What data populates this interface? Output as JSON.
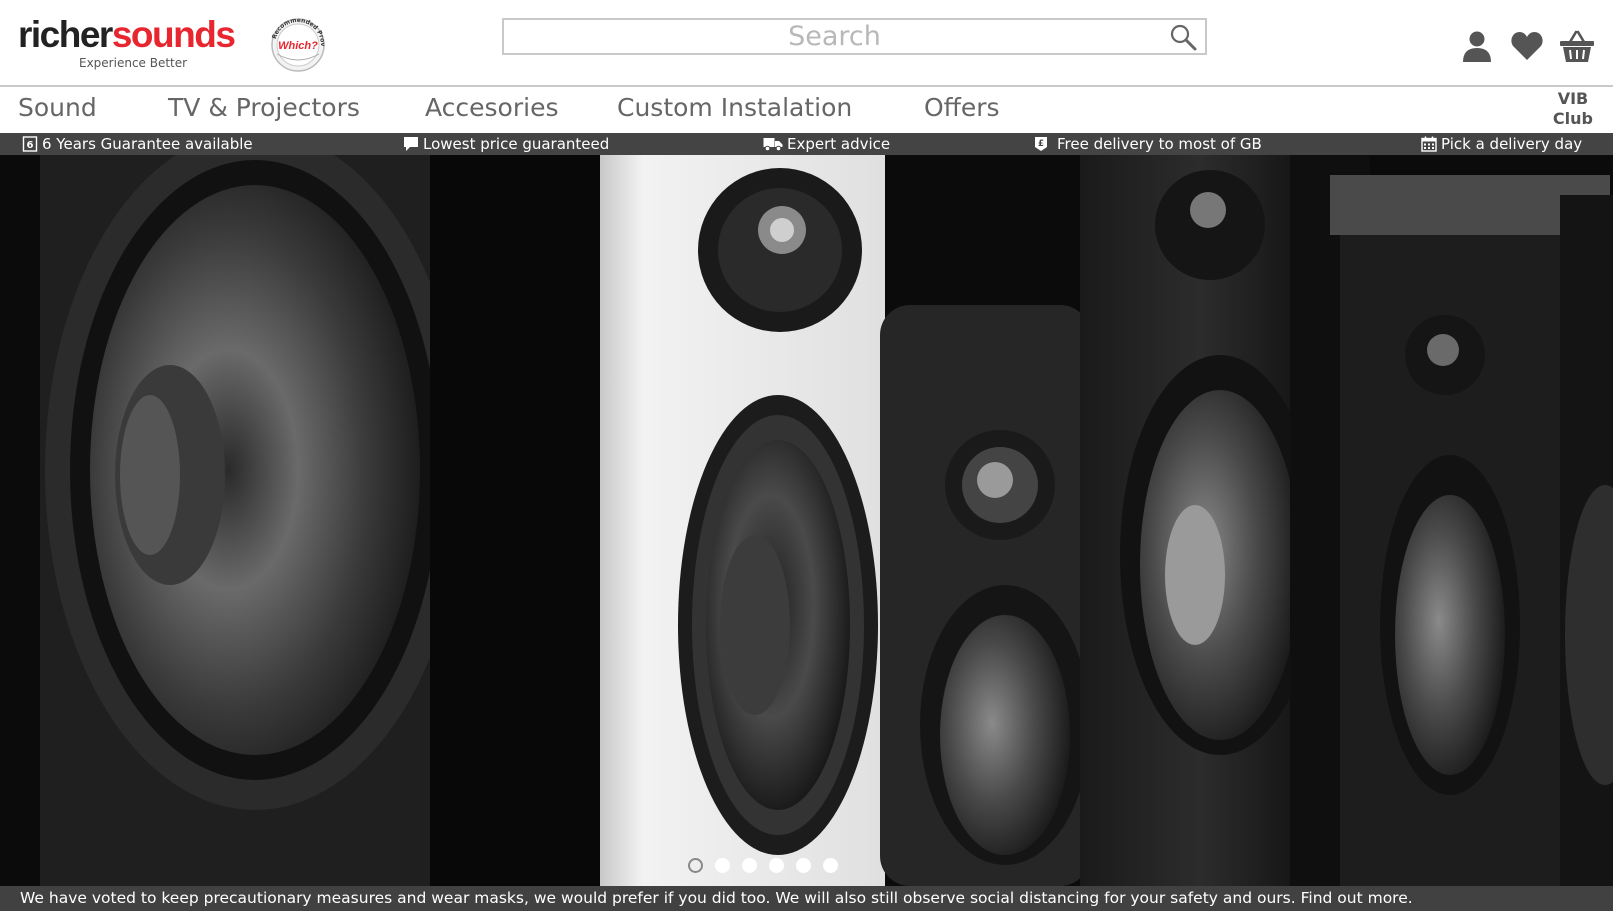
{
  "brand": {
    "name_part1": "richer",
    "name_part2": "sounds",
    "tagline": "Experience Better",
    "badge_top": "Recommended Provider",
    "badge_center": "Which?",
    "colors": {
      "accent": "#e8262f",
      "dark": "#222222"
    }
  },
  "search": {
    "placeholder": "Search",
    "value": "",
    "icon": "search-icon"
  },
  "header_icons": [
    {
      "name": "account",
      "icon": "user-icon"
    },
    {
      "name": "wishlist",
      "icon": "heart-icon"
    },
    {
      "name": "basket",
      "icon": "basket-icon"
    }
  ],
  "nav": {
    "items": [
      "Sound",
      "TV & Projectors",
      "Accesories",
      "Custom Instalation",
      "Offers"
    ],
    "vib_line1": "VIB",
    "vib_line2": "Club"
  },
  "usp": [
    {
      "text": "6 Years Guarantee available",
      "icon": "guarantee-icon",
      "badge": "6"
    },
    {
      "text": "Lowest price guaranteed",
      "icon": "speech-bubble-icon"
    },
    {
      "text": "Expert advice",
      "icon": "truck-icon"
    },
    {
      "text": "Free delivery to most of GB",
      "icon": "pound-tag-icon",
      "badge": "£"
    },
    {
      "text": "Pick a delivery day",
      "icon": "calendar-icon"
    }
  ],
  "hero": {
    "image": "black-and-white speaker drivers",
    "slides": 6,
    "active_slide": 2
  },
  "notice": {
    "text": "We have voted to keep precautionary measures and wear masks, we would prefer if you did too. We will also still observe social distancing for your safety and ours.",
    "link": "Find out more."
  }
}
